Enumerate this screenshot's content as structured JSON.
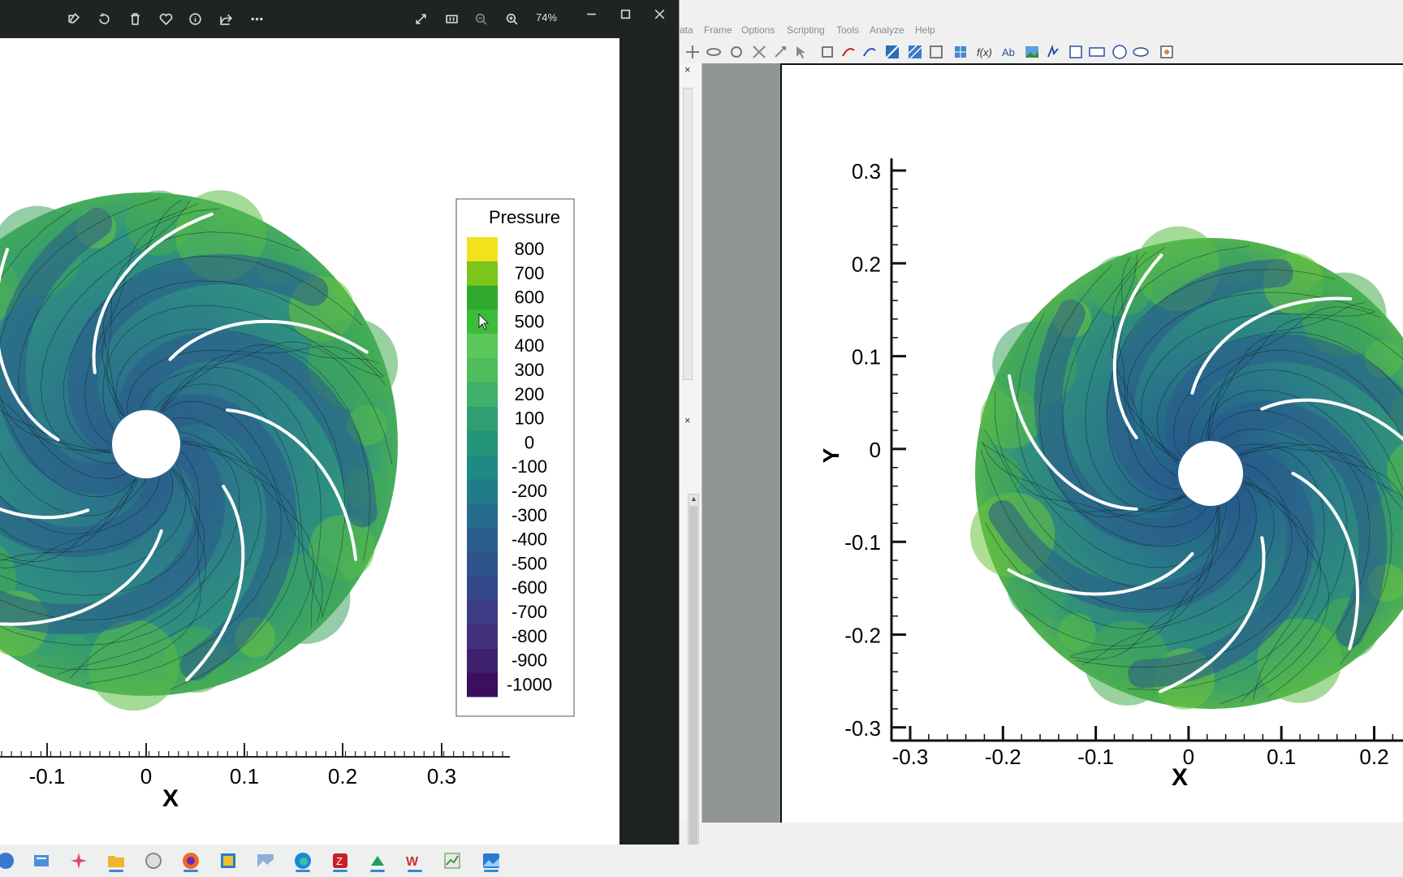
{
  "viewer": {
    "zoom": "74%",
    "toolbar_icons": [
      "edit-icon",
      "rotate-icon",
      "delete-icon",
      "favorite-icon",
      "info-icon",
      "share-icon",
      "more-icon"
    ],
    "right_icons": [
      "fullscreen-icon",
      "actual-size-icon",
      "zoom-out-icon",
      "zoom-in-icon"
    ],
    "window_controls": [
      "minimize-icon",
      "maximize-icon",
      "close-icon"
    ],
    "legend": {
      "title": "Pressure",
      "levels": [
        "800",
        "700",
        "600",
        "500",
        "400",
        "300",
        "200",
        "100",
        "0",
        "-100",
        "-200",
        "-300",
        "-400",
        "-500",
        "-600",
        "-700",
        "-800",
        "-900",
        "-1000"
      ]
    },
    "x_axis": {
      "label": "X",
      "ticks": [
        "-0.1",
        "0",
        "0.1",
        "0.2",
        "0.3"
      ]
    }
  },
  "tecplot": {
    "menu": [
      "ata",
      "Frame",
      "Options",
      "Scripting",
      "Tools",
      "Analyze",
      "Help"
    ],
    "x_axis": {
      "label": "X",
      "ticks": [
        "-0.3",
        "-0.2",
        "-0.1",
        "0",
        "0.1",
        "0.2"
      ]
    },
    "y_axis": {
      "label": "Y",
      "ticks": [
        "0.3",
        "0.2",
        "0.1",
        "0",
        "-0.1",
        "-0.2",
        "-0.3"
      ]
    },
    "panel_close": "×"
  },
  "colors": {
    "legend": [
      "#f2e21c",
      "#7cc51d",
      "#2fa82e",
      "#3cbd3a",
      "#5cc75a",
      "#4fbd5e",
      "#3fb06a",
      "#2f9f72",
      "#249579",
      "#1f8a84",
      "#217c8a",
      "#256b8c",
      "#2a5f8c",
      "#2e548b",
      "#334789",
      "#3c3b84",
      "#41307b",
      "#3e216d",
      "#3b0f5c"
    ],
    "disk_base": "#2f8a86",
    "accent": "#3a86d8"
  },
  "taskbar": {
    "apps": [
      "start-icon",
      "file-viewer-icon",
      "pinwheel-icon",
      "files-folder-icon",
      "browser-settings-icon",
      "firefox-icon",
      "notebook-icon",
      "image-viewer-icon",
      "edge-icon",
      "zotero-icon",
      "snippet-icon",
      "wps-icon",
      "spreadsheet-chart-icon",
      "photos-icon"
    ]
  }
}
